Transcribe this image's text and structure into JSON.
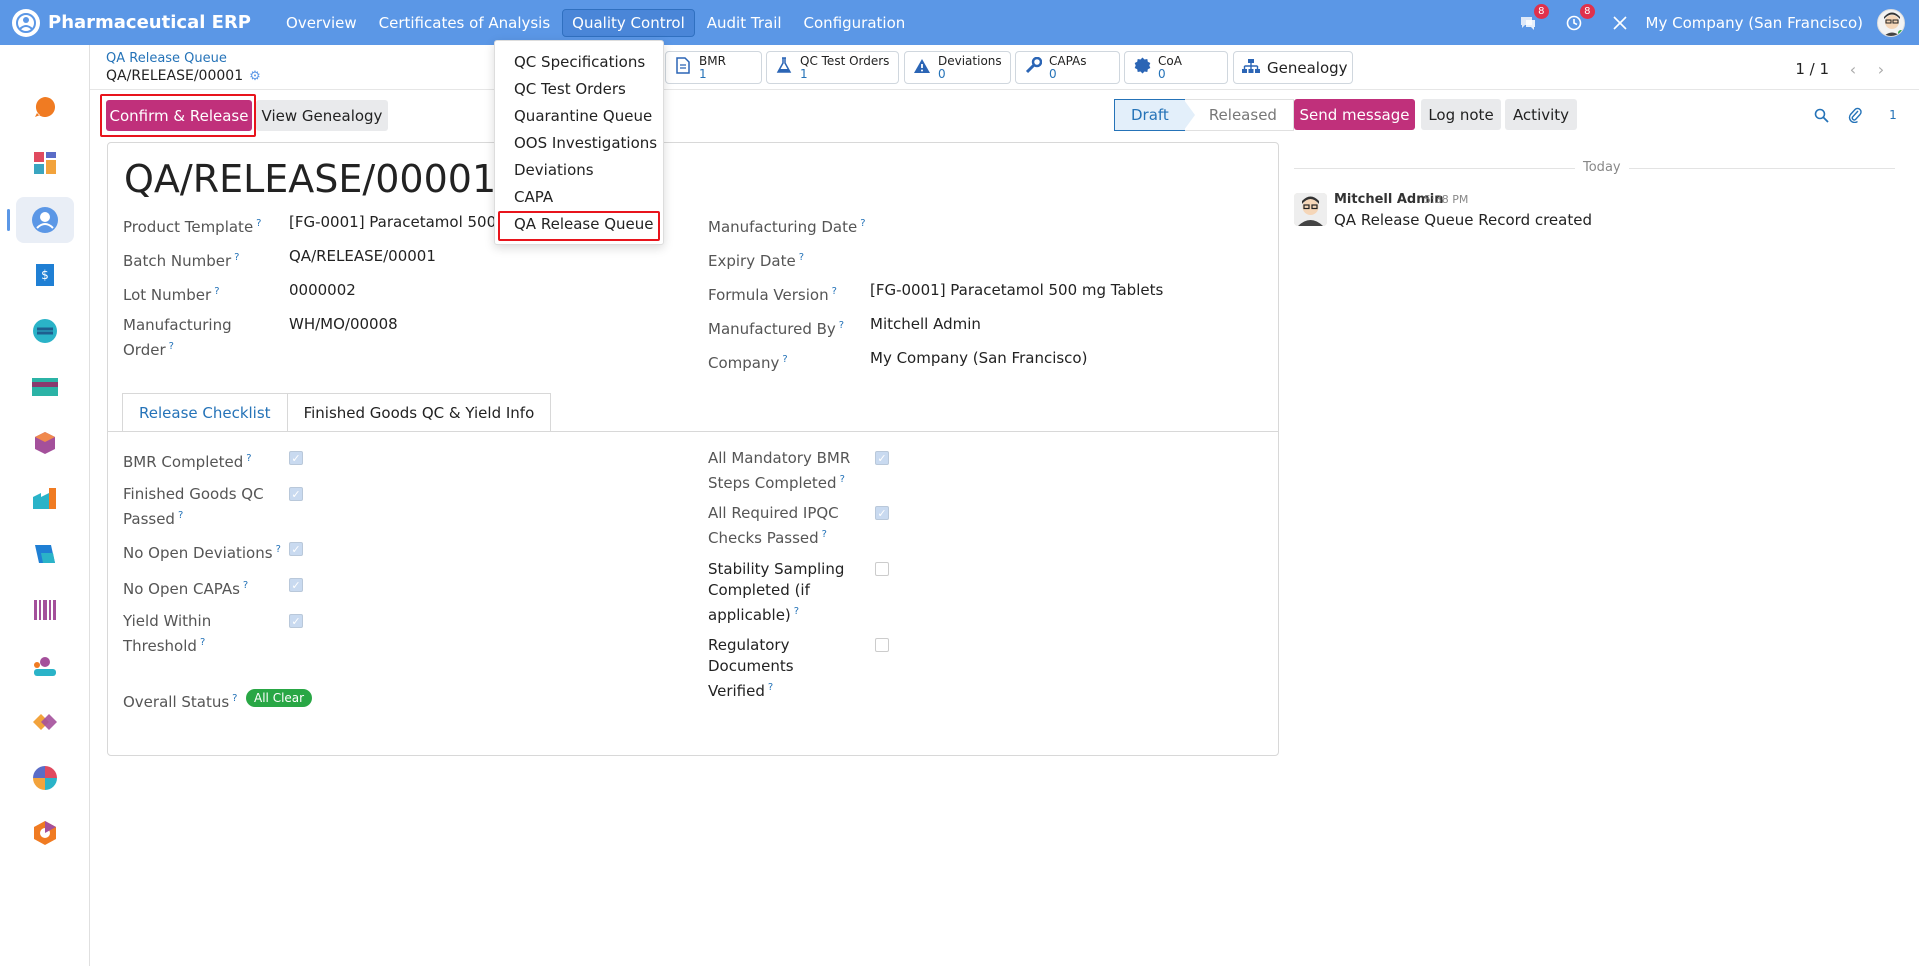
{
  "navbar": {
    "app_title": "Pharmaceutical ERP",
    "menu": [
      "Overview",
      "Certificates of Analysis",
      "Quality Control",
      "Audit Trail",
      "Configuration"
    ],
    "active_menu": "Quality Control",
    "chat_badge": "8",
    "activity_badge": "8",
    "company": "My Company (San Francisco)"
  },
  "dropdown": {
    "items": [
      "QC Specifications",
      "QC Test Orders",
      "Quarantine Queue",
      "OOS Investigations",
      "Deviations",
      "CAPA",
      "QA Release Queue"
    ],
    "highlighted": "QA Release Queue"
  },
  "breadcrumb": {
    "parent": "QA Release Queue",
    "current": "QA/RELEASE/00001"
  },
  "smart_buttons": [
    {
      "label": "BMR",
      "value": "1",
      "icon": "document-icon"
    },
    {
      "label": "QC Test Orders",
      "value": "1",
      "icon": "flask-icon"
    },
    {
      "label": "Deviations",
      "value": "0",
      "icon": "warning-icon"
    },
    {
      "label": "CAPAs",
      "value": "0",
      "icon": "wrench-icon"
    },
    {
      "label": "CoA",
      "value": "0",
      "icon": "certificate-icon"
    },
    {
      "label": "Genealogy",
      "value": "",
      "icon": "sitemap-icon"
    }
  ],
  "pager": {
    "text": "1 / 1"
  },
  "actions": {
    "confirm_release": "Confirm & Release",
    "view_genealogy": "View Genealogy"
  },
  "statusbar": {
    "current": "Draft",
    "next": "Released"
  },
  "record": {
    "title": "QA/RELEASE/00001",
    "left_fields": [
      {
        "label": "Product Template",
        "value": "[FG-0001] Paracetamol 500 mg Tablets"
      },
      {
        "label": "Batch Number",
        "value": "QA/RELEASE/00001"
      },
      {
        "label": "Lot Number",
        "value": "0000002"
      },
      {
        "label": "Manufacturing Order",
        "value": "WH/MO/00008"
      }
    ],
    "right_fields": [
      {
        "label": "Manufacturing Date",
        "value": ""
      },
      {
        "label": "Expiry Date",
        "value": ""
      },
      {
        "label": "Formula Version",
        "value": "[FG-0001] Paracetamol 500 mg Tablets"
      },
      {
        "label": "Manufactured By",
        "value": "Mitchell Admin"
      },
      {
        "label": "Company",
        "value": "My Company (San Francisco)"
      }
    ]
  },
  "tabs": [
    "Release Checklist",
    "Finished Goods QC & Yield Info"
  ],
  "checklist": {
    "left": [
      {
        "label": "BMR Completed",
        "checked": true
      },
      {
        "label": "Finished Goods QC Passed",
        "checked": true
      },
      {
        "label": "No Open Deviations",
        "checked": true
      },
      {
        "label": "No Open CAPAs",
        "checked": true
      },
      {
        "label": "Yield Within Threshold",
        "checked": true
      }
    ],
    "right": [
      {
        "label": "All Mandatory BMR Steps Completed",
        "checked": true
      },
      {
        "label": "All Required IPQC Checks Passed",
        "checked": true
      },
      {
        "label": "Stability Sampling Completed (if applicable)",
        "checked": false
      },
      {
        "label": "Regulatory Documents Verified",
        "checked": false
      }
    ],
    "overall_label": "Overall Status",
    "overall_value": "All Clear"
  },
  "chatter": {
    "send_message": "Send message",
    "log_note": "Log note",
    "activity": "Activity",
    "follower_count": "1",
    "today": "Today",
    "message": {
      "author": "Mitchell Admin",
      "time": "5:38 PM",
      "body": "QA Release Queue Record created"
    }
  },
  "colors": {
    "navbar": "#5b97e6",
    "primary": "#c0307b",
    "link": "#2573b8",
    "highlight": "#e8141c",
    "success": "#29a745"
  }
}
